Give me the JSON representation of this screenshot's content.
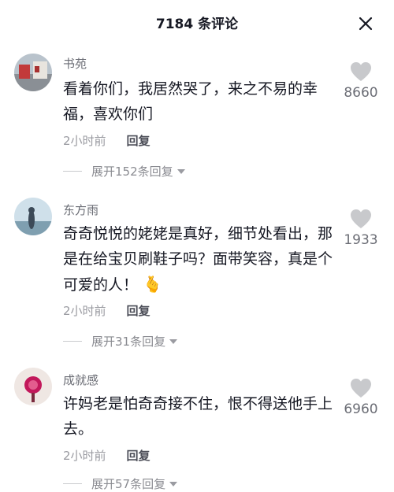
{
  "header": {
    "title": "7184 条评论",
    "close_icon": "close-icon"
  },
  "comments": [
    {
      "username": "书苑",
      "content": "看着你们，我居然哭了，来之不易的幸福，喜欢你们",
      "time": "2小时前",
      "reply_label": "回复",
      "expand_label": "展开152条回复",
      "likes": "8660"
    },
    {
      "username": "东方雨",
      "content": "奇奇悦悦的姥姥是真好，细节处看出，那是在给宝贝刷鞋子吗？面带笑容，真是个可爱的人！",
      "emoji": "🫰",
      "time": "2小时前",
      "reply_label": "回复",
      "expand_label": "展开31条回复",
      "likes": "1933"
    },
    {
      "username": "成就感",
      "content": "许妈老是怕奇奇接不住，恨不得送他手上去。",
      "time": "2小时前",
      "reply_label": "回复",
      "expand_label": "展开57条回复",
      "likes": "6960"
    }
  ],
  "colors": {
    "text": "#161823",
    "secondary": "#6b6d75",
    "muted": "#9a9ba1",
    "heart": "#c8c9cc"
  }
}
